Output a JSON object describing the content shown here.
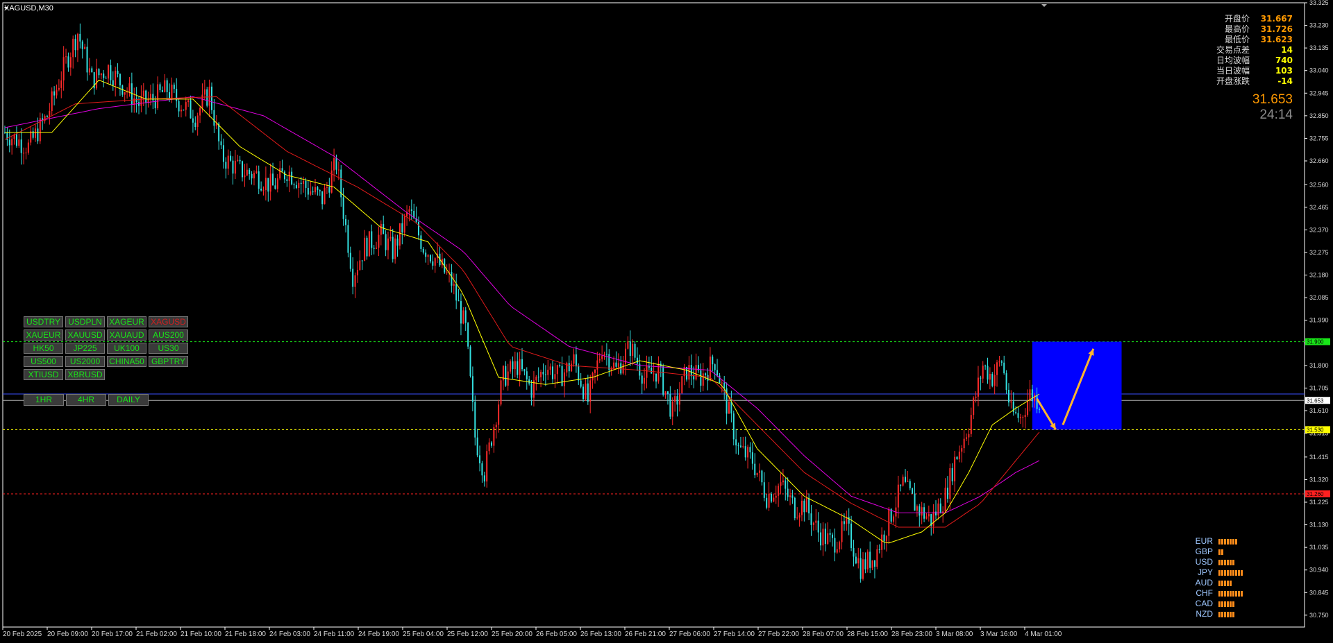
{
  "window": {
    "title": "XAGUSD,M30"
  },
  "chart_data": {
    "type": "candlestick",
    "symbol": "XAGUSD",
    "timeframe": "M30",
    "ylim": [
      30.7,
      33.325
    ],
    "y_ticks": [
      "33.325",
      "33.230",
      "33.135",
      "33.040",
      "32.945",
      "32.850",
      "32.755",
      "32.660",
      "32.560",
      "32.465",
      "32.370",
      "32.275",
      "32.180",
      "32.085",
      "31.990",
      "31.895",
      "31.800",
      "31.705",
      "31.610",
      "31.515",
      "31.415",
      "31.320",
      "31.225",
      "31.130",
      "31.035",
      "30.940",
      "30.845",
      "30.750"
    ],
    "x_ticks": [
      "20 Feb 2025",
      "20 Feb 09:00",
      "20 Feb 17:00",
      "21 Feb 02:00",
      "21 Feb 10:00",
      "21 Feb 18:00",
      "24 Feb 03:00",
      "24 Feb 11:00",
      "24 Feb 19:00",
      "25 Feb 04:00",
      "25 Feb 12:00",
      "25 Feb 20:00",
      "26 Feb 05:00",
      "26 Feb 13:00",
      "26 Feb 21:00",
      "27 Feb 06:00",
      "27 Feb 14:00",
      "27 Feb 22:00",
      "28 Feb 07:00",
      "28 Feb 15:00",
      "28 Feb 23:00",
      "3 Mar 08:00",
      "3 Mar 16:00",
      "4 Mar 01:00"
    ],
    "path": [
      [
        0,
        32.78
      ],
      [
        10,
        32.72
      ],
      [
        18,
        32.85
      ],
      [
        25,
        33.05
      ],
      [
        31,
        33.2
      ],
      [
        37,
        33.0
      ],
      [
        44,
        33.05
      ],
      [
        50,
        32.98
      ],
      [
        57,
        32.9
      ],
      [
        63,
        32.92
      ],
      [
        69,
        32.96
      ],
      [
        75,
        32.9
      ],
      [
        81,
        32.85
      ],
      [
        87,
        32.95
      ],
      [
        92,
        32.68
      ],
      [
        100,
        32.62
      ],
      [
        107,
        32.6
      ],
      [
        114,
        32.55
      ],
      [
        120,
        32.62
      ],
      [
        128,
        32.55
      ],
      [
        135,
        32.5
      ],
      [
        141,
        32.65
      ],
      [
        148,
        32.18
      ],
      [
        153,
        32.3
      ],
      [
        160,
        32.35
      ],
      [
        165,
        32.28
      ],
      [
        172,
        32.45
      ],
      [
        178,
        32.3
      ],
      [
        183,
        32.25
      ],
      [
        190,
        32.15
      ],
      [
        196,
        31.95
      ],
      [
        200,
        31.5
      ],
      [
        204,
        31.35
      ],
      [
        208,
        31.55
      ],
      [
        212,
        31.75
      ],
      [
        218,
        31.8
      ],
      [
        224,
        31.7
      ],
      [
        230,
        31.8
      ],
      [
        236,
        31.75
      ],
      [
        242,
        31.82
      ],
      [
        248,
        31.65
      ],
      [
        254,
        31.88
      ],
      [
        260,
        31.78
      ],
      [
        266,
        31.88
      ],
      [
        272,
        31.75
      ],
      [
        278,
        31.78
      ],
      [
        284,
        31.6
      ],
      [
        290,
        31.78
      ],
      [
        296,
        31.75
      ],
      [
        302,
        31.82
      ],
      [
        308,
        31.6
      ],
      [
        312,
        31.45
      ],
      [
        318,
        31.4
      ],
      [
        324,
        31.25
      ],
      [
        330,
        31.3
      ],
      [
        336,
        31.2
      ],
      [
        340,
        31.22
      ],
      [
        346,
        31.1
      ],
      [
        352,
        31.05
      ],
      [
        358,
        31.12
      ],
      [
        364,
        30.95
      ],
      [
        370,
        31.0
      ],
      [
        376,
        31.15
      ],
      [
        382,
        31.3
      ],
      [
        388,
        31.2
      ],
      [
        394,
        31.15
      ],
      [
        400,
        31.25
      ],
      [
        404,
        31.4
      ],
      [
        410,
        31.55
      ],
      [
        416,
        31.8
      ],
      [
        420,
        31.75
      ],
      [
        424,
        31.82
      ],
      [
        428,
        31.6
      ],
      [
        432,
        31.58
      ],
      [
        436,
        31.68
      ],
      [
        440,
        31.65
      ]
    ],
    "ma_yellow": [
      [
        0,
        32.78
      ],
      [
        20,
        32.78
      ],
      [
        40,
        33.0
      ],
      [
        60,
        32.92
      ],
      [
        80,
        32.92
      ],
      [
        100,
        32.72
      ],
      [
        120,
        32.6
      ],
      [
        140,
        32.55
      ],
      [
        160,
        32.38
      ],
      [
        180,
        32.32
      ],
      [
        195,
        32.1
      ],
      [
        210,
        31.75
      ],
      [
        230,
        31.72
      ],
      [
        250,
        31.75
      ],
      [
        270,
        31.82
      ],
      [
        290,
        31.78
      ],
      [
        305,
        31.72
      ],
      [
        320,
        31.45
      ],
      [
        340,
        31.25
      ],
      [
        360,
        31.15
      ],
      [
        375,
        31.05
      ],
      [
        390,
        31.1
      ],
      [
        400,
        31.18
      ],
      [
        410,
        31.35
      ],
      [
        420,
        31.55
      ],
      [
        430,
        31.62
      ],
      [
        440,
        31.68
      ]
    ],
    "ma_red": [
      [
        0,
        32.75
      ],
      [
        30,
        32.9
      ],
      [
        60,
        32.92
      ],
      [
        90,
        32.93
      ],
      [
        120,
        32.7
      ],
      [
        150,
        32.55
      ],
      [
        175,
        32.4
      ],
      [
        195,
        32.2
      ],
      [
        215,
        31.88
      ],
      [
        240,
        31.8
      ],
      [
        270,
        31.78
      ],
      [
        300,
        31.75
      ],
      [
        320,
        31.55
      ],
      [
        340,
        31.35
      ],
      [
        360,
        31.22
      ],
      [
        380,
        31.12
      ],
      [
        400,
        31.12
      ],
      [
        415,
        31.22
      ],
      [
        430,
        31.4
      ],
      [
        440,
        31.52
      ]
    ],
    "ma_magenta": [
      [
        0,
        32.8
      ],
      [
        40,
        32.88
      ],
      [
        80,
        32.93
      ],
      [
        110,
        32.85
      ],
      [
        140,
        32.68
      ],
      [
        170,
        32.45
      ],
      [
        195,
        32.28
      ],
      [
        215,
        32.05
      ],
      [
        240,
        31.88
      ],
      [
        270,
        31.8
      ],
      [
        300,
        31.78
      ],
      [
        320,
        31.62
      ],
      [
        340,
        31.42
      ],
      [
        360,
        31.25
      ],
      [
        380,
        31.18
      ],
      [
        400,
        31.18
      ],
      [
        415,
        31.25
      ],
      [
        430,
        31.35
      ],
      [
        440,
        31.4
      ]
    ],
    "levels": [
      {
        "price": "31.900",
        "color": "#19e619"
      },
      {
        "price": "31.530",
        "color": "#ffff00"
      },
      {
        "price": "31.260",
        "color": "#ff2020"
      },
      {
        "price": "31.653",
        "color": "#d9d9d9"
      }
    ],
    "box": {
      "x0": 437,
      "x1": 475,
      "y0": 31.53,
      "y1": 31.9,
      "color": "#0000ff"
    },
    "arrows": [
      {
        "from": [
          439,
          31.66
        ],
        "to": [
          447,
          31.53
        ]
      },
      {
        "from": [
          450,
          31.55
        ],
        "to": [
          463,
          31.87
        ]
      }
    ],
    "current_price_line": 31.68
  },
  "symbols": [
    [
      "USDTRY",
      "USDPLN",
      "XAGEUR",
      "XAGUSD"
    ],
    [
      "XAUEUR",
      "XAUUSD",
      "XAUAUD",
      "AUS200"
    ],
    [
      "HK50",
      "JP225",
      "UK100",
      "US30"
    ],
    [
      "US500",
      "US2000",
      "CHINA50",
      "GBPTRY"
    ],
    [
      "XTIUSD",
      "XBRUSD"
    ]
  ],
  "active_symbol": "XAGUSD",
  "timeframes": [
    "1HR",
    "4HR",
    "DAILY"
  ],
  "info": [
    {
      "label": "开盘价",
      "value": "31.667",
      "color": "#ff9900"
    },
    {
      "label": "最高价",
      "value": "31.726",
      "color": "#ff9900"
    },
    {
      "label": "最低价",
      "value": "31.623",
      "color": "#ff9900"
    },
    {
      "label": "交易点差",
      "value": "14",
      "color": "#ffff00"
    },
    {
      "label": "日均波幅",
      "value": "740",
      "color": "#ffff00"
    },
    {
      "label": "当日波幅",
      "value": "103",
      "color": "#ffff00"
    },
    {
      "label": "开盘涨跌",
      "value": "-14",
      "color": "#ffff00"
    }
  ],
  "big_price": "31.653",
  "timer": "24:14",
  "currency_strength": [
    {
      "name": "EUR",
      "bars": 7
    },
    {
      "name": "GBP",
      "bars": 2
    },
    {
      "name": "USD",
      "bars": 6
    },
    {
      "name": "JPY",
      "bars": 9
    },
    {
      "name": "AUD",
      "bars": 5
    },
    {
      "name": "CHF",
      "bars": 9
    },
    {
      "name": "CAD",
      "bars": 6
    },
    {
      "name": "NZD",
      "bars": 6
    }
  ]
}
